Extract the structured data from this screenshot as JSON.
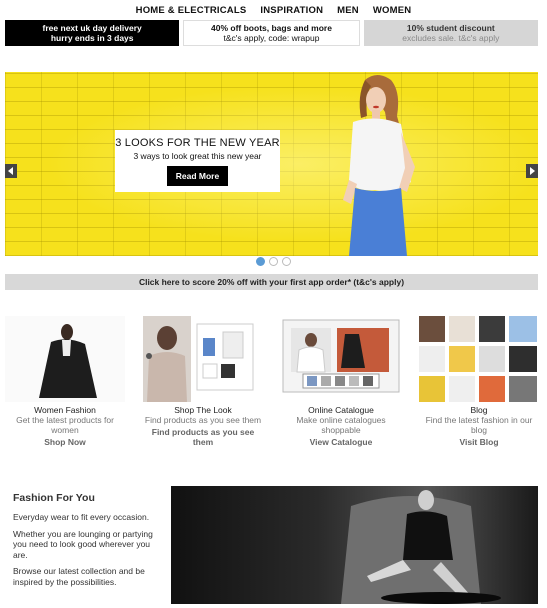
{
  "nav": {
    "items": [
      "HOME & ELECTRICALS",
      "INSPIRATION",
      "MEN",
      "WOMEN"
    ]
  },
  "promos": [
    {
      "line1": "free next uk day delivery",
      "line2": "hurry ends in 3 days"
    },
    {
      "line1": "40% off boots, bags and more",
      "line2": "t&c's apply, code: wrapup"
    },
    {
      "line1": "10% student discount",
      "line2": "excludes sale. t&c's apply"
    }
  ],
  "hero": {
    "title": "3 LOOKS FOR THE NEW YEAR",
    "subtitle": "3 ways to look great this new year",
    "button": "Read More",
    "slide_count": 3,
    "active_slide": 1,
    "left_arrow": "chevron-left-icon",
    "right_arrow": "chevron-right-icon"
  },
  "app_banner": "Click here to score 20% off with your first app order* (t&c's apply)",
  "tiles": [
    {
      "title": "Women Fashion",
      "desc": "Get the latest products for women",
      "link": "Shop Now"
    },
    {
      "title": "Shop The Look",
      "desc": "Find products as you see them",
      "link": "Find products as you see them"
    },
    {
      "title": "Online Catalogue",
      "desc": "Make online catalogues shoppable",
      "link": "View Catalogue"
    },
    {
      "title": "Blog",
      "desc": "Find the latest fashion in our blog",
      "link": "Visit Blog"
    }
  ],
  "fashion": {
    "heading": "Fashion For You",
    "p1": "Everyday wear to fit every occasion.",
    "p2": "Whether you are lounging or partying you need to look good wherever you are.",
    "p3": "Browse our latest collection and be inspired by the possibilities."
  },
  "colors": {
    "hero_bg": "#f6e11c",
    "active_dot": "#5b9bd5",
    "promo_dark": "#000000",
    "banner_grey": "#d8d8d8"
  }
}
